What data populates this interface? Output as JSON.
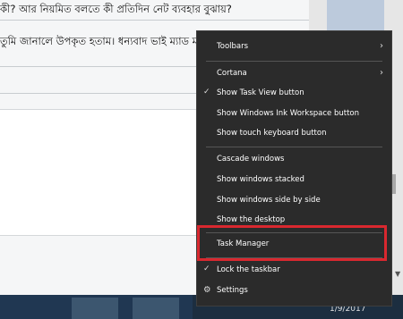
{
  "page": {
    "line1": "কী? আর নিয়মিত বলতে কী প্রতিদিন নেট ব্যবহার বুঝায়?",
    "line2": "তুমি জানালে উপকৃত হতাম। ধন্যবাদ ভাই ম্যাড ম"
  },
  "menu": {
    "toolbars": "Toolbars",
    "cortana": "Cortana",
    "show_task_view": "Show Task View button",
    "show_ink_workspace": "Show Windows Ink Workspace button",
    "show_touch_keyboard": "Show touch keyboard button",
    "cascade": "Cascade windows",
    "stacked": "Show windows stacked",
    "side_by_side": "Show windows side by side",
    "show_desktop": "Show the desktop",
    "task_manager": "Task Manager",
    "lock_taskbar": "Lock the taskbar",
    "settings": "Settings",
    "checked_items": [
      "Show Task View button",
      "Lock the taskbar"
    ]
  },
  "taskbar": {
    "date": "1/9/2017"
  },
  "icons": {
    "chevron": "›",
    "check": "✓",
    "gear": "⚙"
  },
  "colors": {
    "menu_bg": "#2b2b2b",
    "highlight": "#d9282f",
    "taskbar": "#1c2e40"
  }
}
